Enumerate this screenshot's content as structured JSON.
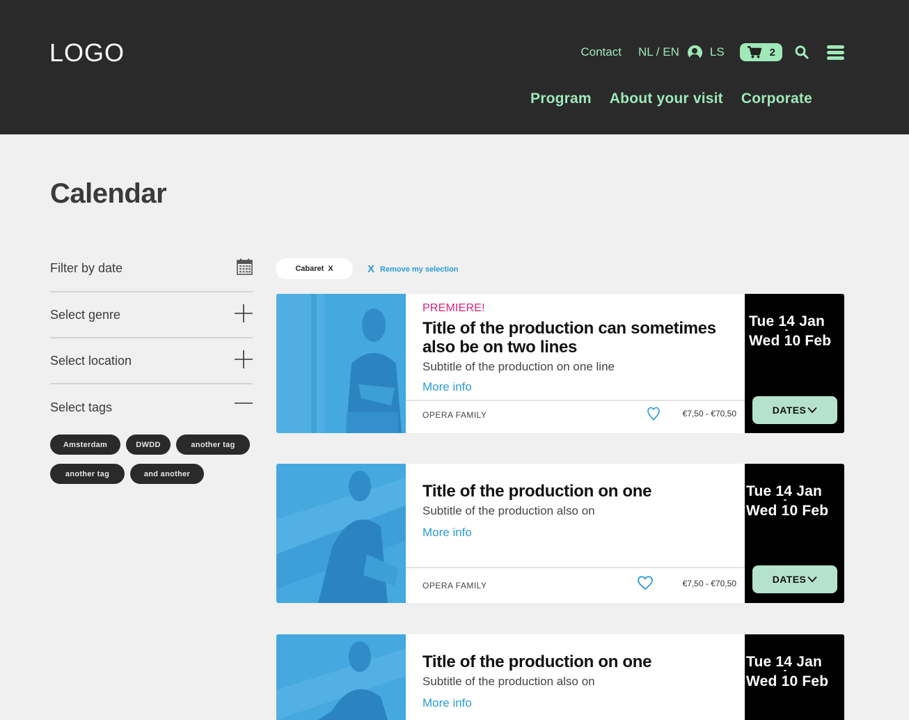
{
  "header": {
    "logo": "LOGO",
    "contact": "Contact",
    "language": "NL / EN",
    "user_initials": "LS",
    "cart_count": "2",
    "main_nav": [
      "Program",
      "About your visit",
      "Corporate"
    ]
  },
  "page": {
    "title": "Calendar"
  },
  "sidebar": {
    "filters": [
      {
        "label": "Filter by date",
        "control": "calendar-icon"
      },
      {
        "label": "Select genre",
        "control": "plus-icon"
      },
      {
        "label": "Select location",
        "control": "plus-icon"
      },
      {
        "label": "Select tags",
        "control": "minus-icon"
      }
    ],
    "tags": [
      "Amsterdam",
      "DWDD",
      "another tag",
      "another tag",
      "and another"
    ]
  },
  "selection": {
    "chip_label": "Cabaret",
    "chip_close": "X",
    "remove_x": "X",
    "remove_label": "Remove my selection"
  },
  "cards": [
    {
      "premiere": "PREMIERE!",
      "title": "Title of the production can sometimes also be on two lines",
      "subtitle": "Subtitle of the production on one line",
      "more_info": "More info",
      "family": "OPERA FAMILY",
      "price": "€7,50 - €70,50",
      "date_start": "Tue 14 Jan",
      "date_sep": "-",
      "date_end": "Wed 10 Feb",
      "dates_button": "DATES"
    },
    {
      "premiere": "",
      "title": "Title of the production on one",
      "subtitle": "Subtitle of the production also on",
      "more_info": "More info",
      "family": "OPERA FAMILY",
      "price": "€7,50 - €70,50",
      "date_start": "Tue 14 Jan",
      "date_sep": "-",
      "date_end": "Wed 10 Feb",
      "dates_button": "DATES"
    },
    {
      "premiere": "",
      "title": "Title of the production on one",
      "subtitle": "Subtitle of the production also on",
      "more_info": "More info",
      "date_start": "Tue 14 Jan",
      "date_sep": "-",
      "date_end": "Wed 10 Feb"
    }
  ],
  "colors": {
    "header_bg": "#2a2a2a",
    "accent_green": "#9fe8b8",
    "image_blue": "#45a8df",
    "link_blue": "#2a9bd8",
    "premiere_pink": "#e0207a",
    "dates_button_bg": "#b5e2cc"
  }
}
